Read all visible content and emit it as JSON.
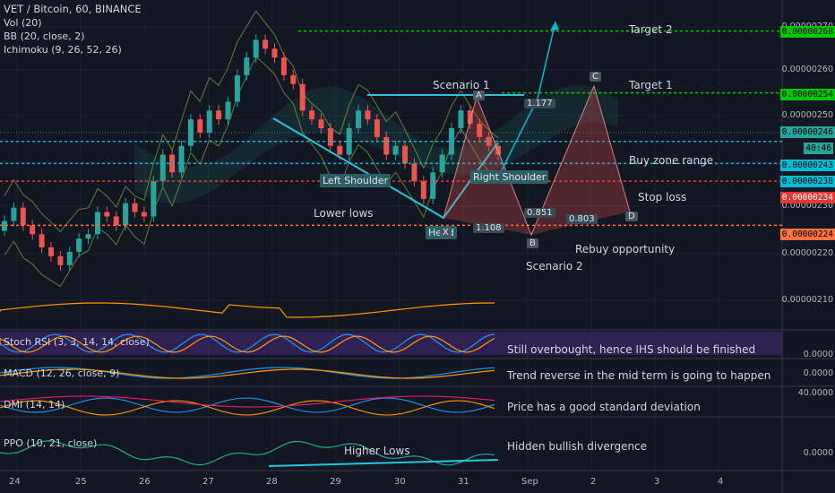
{
  "header": {
    "symbol": "VET / Bitcoin, 60, BINANCE",
    "indicators": [
      "Vol (20)",
      "BB (20, close, 2)",
      "Ichimoku (9, 26, 52, 26)"
    ]
  },
  "panels": {
    "stoch": "Stoch RSI (3, 3, 14, 14, close)",
    "macd": "MACD (12, 26, close, 9)",
    "dmi": "DMI (14, 14)",
    "ppo": "PPO (10, 21, close)"
  },
  "annotations": {
    "target2": "Target 2",
    "target1": "Target 1",
    "scenario1": "Scenario 1",
    "scenario2": "Scenario 2",
    "buy_zone": "Buy zone range",
    "stop_loss": "Stop loss",
    "rebuy": "Rebuy opportunity",
    "lower_lows": "Lower lows",
    "left_shoulder": "Left Shoulder",
    "right_shoulder": "Right Shoulder",
    "head": "Head",
    "higher_lows": "Higher Lows",
    "stoch_note": "Still overbought, hence IHS should be finished",
    "macd_note": "Trend reverse in the mid term is going to happen",
    "dmi_note": "Price has a good standard deviation",
    "ppo_note": "Hidden bullish divergence"
  },
  "pattern_points": {
    "A": "A",
    "B": "B",
    "C": "C",
    "D": "D",
    "X": "X"
  },
  "ratios": {
    "r1": "1.177",
    "r2": "1.108",
    "r3": "0.851",
    "r4": "0.803"
  },
  "price_axis": {
    "ticks": [
      "0.00000270",
      "0.00000260",
      "0.00000250",
      "0.00000230",
      "0.00000220",
      "0.00000210",
      "0.0000",
      "0.0000",
      "40.0000",
      "0.0000"
    ],
    "badges": [
      {
        "label": "0.00000268",
        "color": "#00c800"
      },
      {
        "label": "0.00000254",
        "color": "#00c800"
      },
      {
        "label": "0.00000246",
        "color": "#26a69a"
      },
      {
        "label": "40:46",
        "color": "#26a69a"
      },
      {
        "label": "0.00000243",
        "color": "#00bcd4"
      },
      {
        "label": "0.00000238",
        "color": "#00bcd4"
      },
      {
        "label": "0.00000234",
        "color": "#e53935"
      },
      {
        "label": "0.00000224",
        "color": "#ff7043"
      }
    ]
  },
  "date_axis": [
    "24",
    "25",
    "26",
    "27",
    "28",
    "29",
    "30",
    "31",
    "Sep",
    "2",
    "3",
    "4"
  ],
  "chart_data": {
    "type": "candlestick",
    "title": "VET / Bitcoin, 60, BINANCE",
    "xlabel": "",
    "ylabel": "",
    "x_categories": [
      "24",
      "25",
      "26",
      "27",
      "28",
      "29",
      "30",
      "31",
      "Sep",
      "2",
      "3",
      "4"
    ],
    "ylim": [
      2.05e-06,
      2.73e-06
    ],
    "levels": [
      {
        "name": "Target 2",
        "value": 2.68e-06,
        "color": "#00c800"
      },
      {
        "name": "Target 1",
        "value": 2.54e-06,
        "color": "#00c800"
      },
      {
        "name": "Buy zone range",
        "value": 2.43e-06,
        "color": "#00bcd4"
      },
      {
        "name": "Buy zone range",
        "value": 2.38e-06,
        "color": "#00bcd4"
      },
      {
        "name": "Stop loss",
        "value": 2.34e-06,
        "color": "#e53935"
      },
      {
        "name": "Rebuy opportunity",
        "value": 2.24e-06,
        "color": "#ff7043"
      }
    ],
    "series": [
      {
        "name": "close",
        "values": [
          2.25e-06,
          2.28e-06,
          2.24e-06,
          2.22e-06,
          2.19e-06,
          2.17e-06,
          2.15e-06,
          2.18e-06,
          2.21e-06,
          2.22e-06,
          2.27e-06,
          2.26e-06,
          2.24e-06,
          2.29e-06,
          2.27e-06,
          2.26e-06,
          2.34e-06,
          2.4e-06,
          2.36e-06,
          2.42e-06,
          2.48e-06,
          2.45e-06,
          2.5e-06,
          2.48e-06,
          2.52e-06,
          2.58e-06,
          2.62e-06,
          2.66e-06,
          2.64e-06,
          2.62e-06,
          2.58e-06,
          2.56e-06,
          2.5e-06,
          2.48e-06,
          2.46e-06,
          2.42e-06,
          2.4e-06,
          2.46e-06,
          2.5e-06,
          2.48e-06,
          2.44e-06,
          2.4e-06,
          2.42e-06,
          2.38e-06,
          2.34e-06,
          2.3e-06,
          2.36e-06,
          2.4e-06,
          2.46e-06,
          2.5e-06,
          2.47e-06,
          2.44e-06,
          2.42e-06,
          2.4e-06
        ]
      }
    ]
  }
}
